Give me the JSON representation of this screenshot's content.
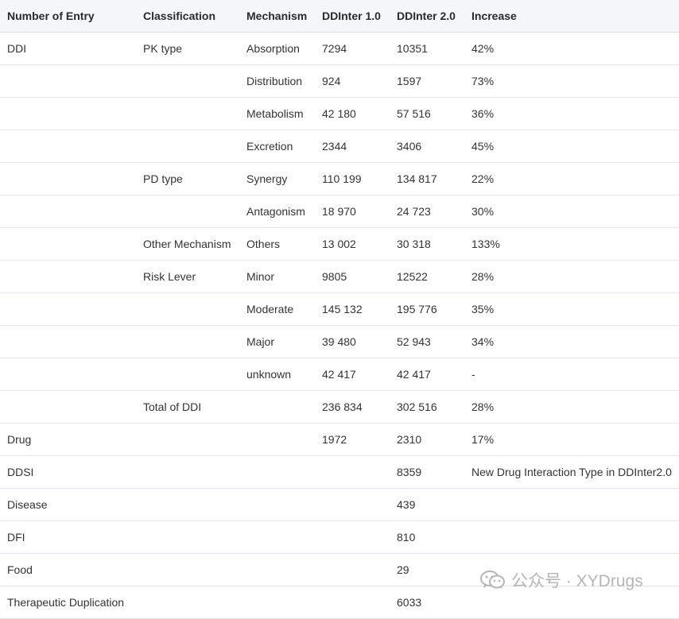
{
  "table": {
    "headers": [
      "Number of Entry",
      "Classification",
      "Mechanism",
      "DDInter 1.0",
      "DDInter 2.0",
      "Increase"
    ],
    "rows": [
      [
        "DDI",
        "PK type",
        "Absorption",
        "7294",
        "10351",
        "42%"
      ],
      [
        "",
        "",
        "Distribution",
        "924",
        "1597",
        "73%"
      ],
      [
        "",
        "",
        "Metabolism",
        "42 180",
        "57 516",
        "36%"
      ],
      [
        "",
        "",
        "Excretion",
        "2344",
        "3406",
        "45%"
      ],
      [
        "",
        "PD type",
        "Synergy",
        "110 199",
        "134 817",
        "22%"
      ],
      [
        "",
        "",
        "Antagonism",
        "18 970",
        "24 723",
        "30%"
      ],
      [
        "",
        "Other Mechanism",
        "Others",
        "13 002",
        "30 318",
        "133%"
      ],
      [
        "",
        "Risk Lever",
        "Minor",
        "9805",
        "12522",
        "28%"
      ],
      [
        "",
        "",
        "Moderate",
        "145 132",
        "195 776",
        "35%"
      ],
      [
        "",
        "",
        "Major",
        "39 480",
        "52 943",
        "34%"
      ],
      [
        "",
        "",
        "unknown",
        "42 417",
        "42 417",
        "-"
      ],
      [
        "",
        "Total of DDI",
        "",
        "236 834",
        "302 516",
        "28%"
      ],
      [
        "Drug",
        "",
        "",
        "1972",
        "2310",
        "17%"
      ],
      [
        "DDSI",
        "",
        "",
        "",
        "8359",
        "New Drug Interaction Type in DDInter2.0"
      ],
      [
        "Disease",
        "",
        "",
        "",
        "439",
        ""
      ],
      [
        "DFI",
        "",
        "",
        "",
        "810",
        ""
      ],
      [
        "Food",
        "",
        "",
        "",
        "29",
        ""
      ],
      [
        "Therapeutic Duplication",
        "",
        "",
        "",
        "6033",
        ""
      ]
    ]
  },
  "watermark": {
    "icon": "wechat-icon",
    "text": "公众号 · XYDrugs"
  }
}
